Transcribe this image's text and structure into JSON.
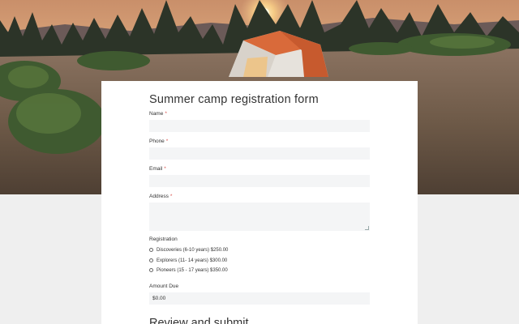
{
  "form": {
    "title": "Summer camp registration form",
    "required_marker": "*",
    "fields": {
      "name_label": "Name",
      "phone_label": "Phone",
      "email_label": "Email",
      "address_label": "Address"
    },
    "registration": {
      "label": "Registration",
      "options": [
        "Discoveries (6-10 years) $250.00",
        "Explorers (11- 14 years) $300.00",
        "Pioneers (15 - 17 years) $350.00"
      ]
    },
    "amount_due": {
      "label": "Amount Due",
      "value": "$0.00"
    },
    "next_section_title": "Review and submit"
  },
  "hero": {
    "sky_top": "#e9b98a",
    "sun": "#fff3c0",
    "tent_orange": "#d96a3a",
    "ground": "#6b5a4a"
  }
}
